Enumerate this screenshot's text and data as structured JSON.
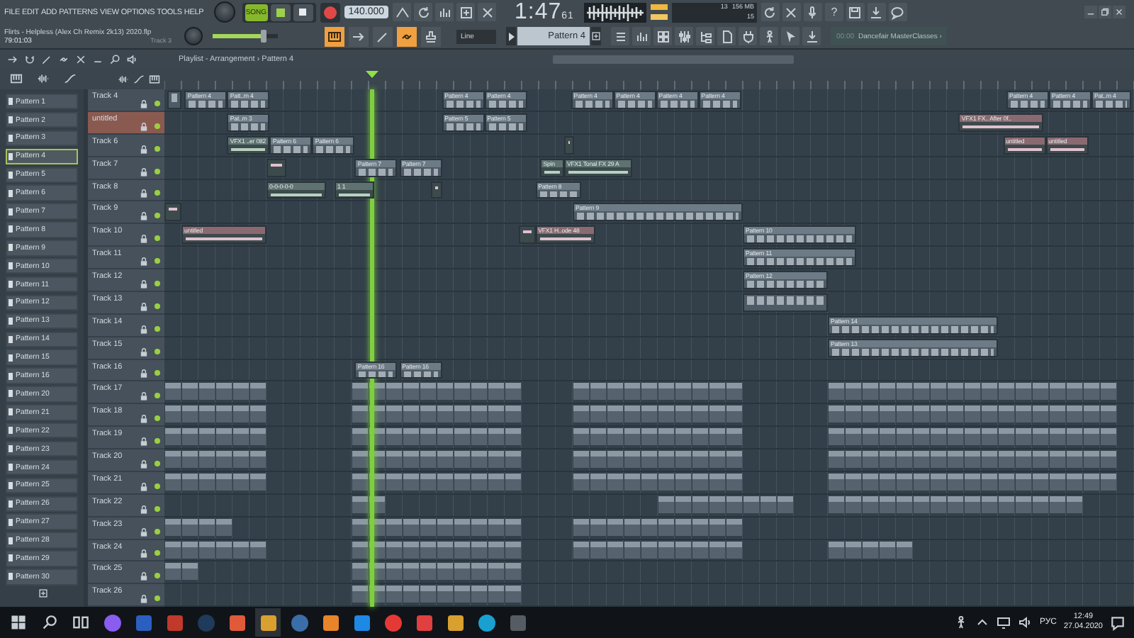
{
  "menu": [
    "FILE",
    "EDIT",
    "ADD",
    "PATTERNS",
    "VIEW",
    "OPTIONS",
    "TOOLS",
    "HELP"
  ],
  "transport": {
    "mode_label": "SONG",
    "song_mode": true,
    "tempo": "140.000",
    "time_main": "1:47",
    "time_sub": "61"
  },
  "project": {
    "file": "Flirts - Helpless (Alex Ch Remix 2k13) 2020.flp",
    "position": "79:01:03",
    "hint": "Track 3"
  },
  "master_volume": {
    "level": 0.78
  },
  "cpu": {
    "cpu": "13",
    "memory": "156 MB",
    "polyphony": "15"
  },
  "help_glyph": "?",
  "tool_toggles": [
    {
      "selected": true
    },
    {
      "selected": false
    },
    {
      "selected": false
    },
    {
      "selected": true
    },
    {
      "selected": false
    }
  ],
  "snap": "Line",
  "pattern_selector": "Pattern 4",
  "news": {
    "time": "00:00",
    "text": "Dancefair MasterClasses ›"
  },
  "playlist": {
    "title": "Playlist - Arrangement › Pattern 4"
  },
  "patterns": [
    {
      "name": "Pattern 1",
      "selected": false
    },
    {
      "name": "Pattern 2",
      "selected": false
    },
    {
      "name": "Pattern 3",
      "selected": false
    },
    {
      "name": "Pattern 4",
      "selected": true
    },
    {
      "name": "Pattern 5",
      "selected": false
    },
    {
      "name": "Pattern 6",
      "selected": false
    },
    {
      "name": "Pattern 7",
      "selected": false
    },
    {
      "name": "Pattern 8",
      "selected": false
    },
    {
      "name": "Pattern 9",
      "selected": false
    },
    {
      "name": "Pattern 10",
      "selected": false
    },
    {
      "name": "Pattern 11",
      "selected": false
    },
    {
      "name": "Pattern 12",
      "selected": false
    },
    {
      "name": "Pattern 13",
      "selected": false
    },
    {
      "name": "Pattern 14",
      "selected": false
    },
    {
      "name": "Pattern 15",
      "selected": false
    },
    {
      "name": "Pattern 16",
      "selected": false
    },
    {
      "name": "Pattern 20",
      "selected": false
    },
    {
      "name": "Pattern 21",
      "selected": false
    },
    {
      "name": "Pattern 22",
      "selected": false
    },
    {
      "name": "Pattern 23",
      "selected": false
    },
    {
      "name": "Pattern 24",
      "selected": false
    },
    {
      "name": "Pattern 25",
      "selected": false
    },
    {
      "name": "Pattern 26",
      "selected": false
    },
    {
      "name": "Pattern 27",
      "selected": false
    },
    {
      "name": "Pattern 28",
      "selected": false
    },
    {
      "name": "Pattern 29",
      "selected": false
    },
    {
      "name": "Pattern 30",
      "selected": false
    }
  ],
  "tracks": [
    {
      "name": "Track 4",
      "color": "#46515b",
      "enabled": true,
      "clips": [
        {
          "kind": "pattern"
        },
        {
          "kind": "pattern",
          "label": "Pattern 4"
        },
        {
          "kind": "pattern",
          "label": "Patt..rn 4"
        },
        {
          "kind": "pattern",
          "label": "Pattern 4"
        },
        {
          "kind": "pattern",
          "label": "Pattern 4"
        },
        {
          "kind": "pattern",
          "label": "Pattern 4"
        },
        {
          "kind": "pattern",
          "label": "Pattern 4"
        },
        {
          "kind": "pattern",
          "label": "Pattern 4"
        },
        {
          "kind": "pattern",
          "label": "Pattern 4"
        },
        {
          "kind": "pattern",
          "label": "Pattern 4"
        },
        {
          "kind": "pattern",
          "label": "Pattern 4"
        },
        {
          "kind": "pattern",
          "label": "Pat..rn 4"
        }
      ]
    },
    {
      "name": "untitled",
      "color": "#8a5a50",
      "enabled": true,
      "clips": [
        {
          "kind": "pattern",
          "label": "Pat..rn 3"
        },
        {
          "kind": "pattern",
          "label": "Pattern 5"
        },
        {
          "kind": "pattern",
          "label": "Pattern 5"
        },
        {
          "kind": "audio_red",
          "label": "VFX1 FX.. After 0f.."
        }
      ]
    },
    {
      "name": "Track 6",
      "color": "#46515b",
      "enabled": true,
      "clips": [
        {
          "kind": "audio",
          "label": "VFX1 ..er 082"
        },
        {
          "kind": "pattern",
          "label": "Pattern 6"
        },
        {
          "kind": "pattern",
          "label": "Pattern 6"
        },
        {
          "kind": "audio_red"
        },
        {
          "kind": "audio_red",
          "label": "untitled"
        },
        {
          "kind": "audio_red",
          "label": "untitled"
        }
      ]
    },
    {
      "name": "Track 7",
      "color": "#46515b",
      "enabled": true,
      "clips": [
        {
          "kind": "audio_red"
        },
        {
          "kind": "pattern",
          "label": "Pattern 7"
        },
        {
          "kind": "pattern",
          "label": "Pattern 7"
        },
        {
          "kind": "audio",
          "label": "Spin"
        },
        {
          "kind": "audio",
          "label": "VFX1 Tonal FX 29 A"
        }
      ]
    },
    {
      "name": "Track 8",
      "color": "#46515b",
      "enabled": true,
      "clips": [
        {
          "kind": "audio",
          "label": "0-0-0-0-0"
        },
        {
          "kind": "audio",
          "label": "1 1"
        },
        {
          "kind": "audio_red"
        },
        {
          "kind": "pattern",
          "label": "Pattern 8"
        }
      ]
    },
    {
      "name": "Track 9",
      "color": "#46515b",
      "enabled": true,
      "clips": [
        {
          "kind": "audio_red"
        },
        {
          "kind": "pattern",
          "label": "Pattern 9"
        }
      ]
    },
    {
      "name": "Track 10",
      "color": "#46515b",
      "enabled": true,
      "clips": [
        {
          "kind": "audio_red",
          "label": "untitled"
        },
        {
          "kind": "audio_red"
        },
        {
          "kind": "audio_red",
          "label": "VFX1 H..ode 48"
        },
        {
          "kind": "pattern",
          "label": "Pattern 10"
        }
      ]
    },
    {
      "name": "Track 11",
      "color": "#46515b",
      "enabled": true,
      "clips": [
        {
          "kind": "pattern",
          "label": "Pattern 11"
        }
      ]
    },
    {
      "name": "Track 12",
      "color": "#46515b",
      "enabled": true,
      "clips": [
        {
          "kind": "pattern",
          "label": "Pattern 12"
        }
      ]
    },
    {
      "name": "Track 13",
      "color": "#46515b",
      "enabled": true,
      "clips": [
        {
          "kind": "pattern"
        }
      ]
    },
    {
      "name": "Track 14",
      "color": "#46515b",
      "enabled": true,
      "clips": [
        {
          "kind": "pattern",
          "label": "Pattern 14"
        }
      ]
    },
    {
      "name": "Track 15",
      "color": "#46515b",
      "enabled": true,
      "clips": [
        {
          "kind": "pattern",
          "label": "Pattern 13"
        }
      ]
    },
    {
      "name": "Track 16",
      "color": "#46515b",
      "enabled": true,
      "clips": [
        {
          "kind": "pattern",
          "label": "Pattern 16"
        },
        {
          "kind": "pattern",
          "label": "Pattern 16"
        }
      ]
    },
    {
      "name": "Track 17",
      "color": "#46515b",
      "enabled": true
    },
    {
      "name": "Track 18",
      "color": "#46515b",
      "enabled": true
    },
    {
      "name": "Track 19",
      "color": "#46515b",
      "enabled": true
    },
    {
      "name": "Track 20",
      "color": "#46515b",
      "enabled": true
    },
    {
      "name": "Track 21",
      "color": "#46515b",
      "enabled": true
    },
    {
      "name": "Track 22",
      "color": "#46515b",
      "enabled": true
    },
    {
      "name": "Track 23",
      "color": "#46515b",
      "enabled": true
    },
    {
      "name": "Track 24",
      "color": "#46515b",
      "enabled": true
    },
    {
      "name": "Track 25",
      "color": "#46515b",
      "enabled": true
    },
    {
      "name": "Track 26",
      "color": "#46515b",
      "enabled": true
    }
  ],
  "taskbar": {
    "language": "РУС",
    "time": "12:49",
    "date": "27.04.2020"
  }
}
